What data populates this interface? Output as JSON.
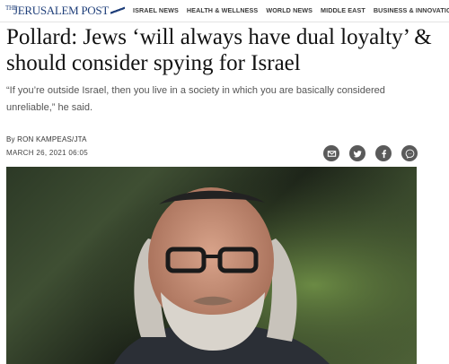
{
  "header": {
    "logo_text": "THE JERUSALEM POST",
    "nav": [
      "ISRAEL NEWS",
      "HEALTH & WELLNESS",
      "WORLD NEWS",
      "MIDDLE EAST",
      "BUSINESS & INNOVATION"
    ]
  },
  "article": {
    "title": "Pollard: Jews ‘will always have dual loyalty’ & should consider spying for Israel",
    "subhead": "“If you’re outside Israel, then you live in a society in which you are basically considered unreliable,” he said.",
    "byline": "By RON KAMPEAS/JTA",
    "date": "MARCH 26, 2021 06:05"
  },
  "share": {
    "icons": [
      "email-icon",
      "twitter-icon",
      "facebook-icon",
      "messenger-icon"
    ],
    "color": "#5a5a5a"
  },
  "colors": {
    "brand": "#1f3f7a"
  }
}
